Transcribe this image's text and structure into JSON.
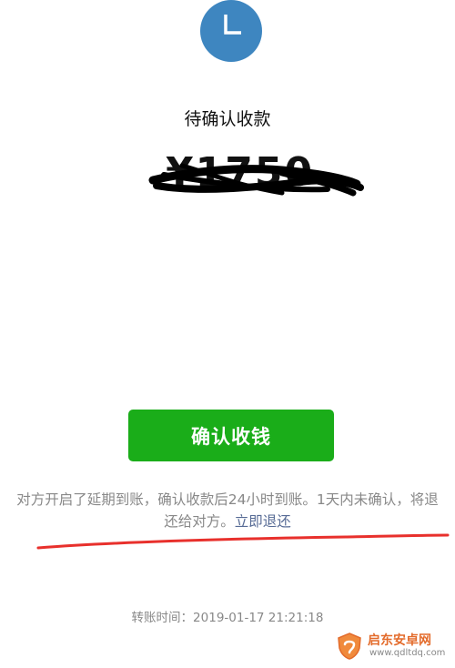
{
  "status": {
    "icon": "clock-icon",
    "icon_color": "#3e86c0",
    "title": "待确认收款"
  },
  "amount": {
    "text": "¥1750",
    "obscured": true
  },
  "actions": {
    "confirm_label": "确认收钱",
    "confirm_color": "#1aad19"
  },
  "notice": {
    "text": "对方开启了延期到账，确认收款后24小时到账。1天内未确认，将退还给对方。",
    "link": "立即退还",
    "link_color": "#576b95"
  },
  "transfer": {
    "label": "转账时间：",
    "time": "2019-01-17 21:21:18"
  },
  "watermark": {
    "name": "启东安卓网",
    "url": "www.qdltdq.com"
  },
  "annotation_color": "#e8302c"
}
